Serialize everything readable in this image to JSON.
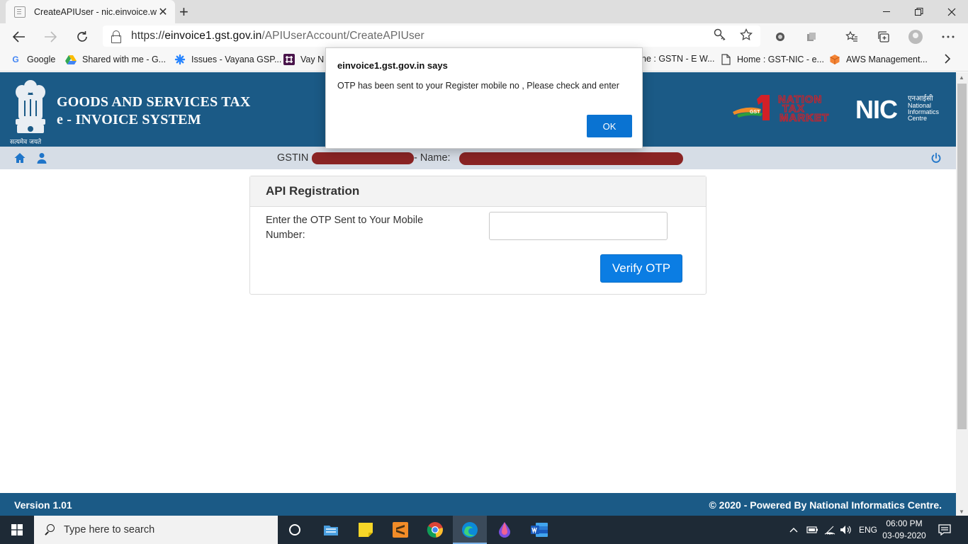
{
  "browser": {
    "tab_title": "CreateAPIUser - nic.einvoice.web",
    "tab_close": "✕",
    "new_tab": "+",
    "url_scheme": "https://",
    "url_host": "einvoice1.gst.gov.in",
    "url_path": "/APIUserAccount/CreateAPIUser",
    "bookmarks": [
      "Google",
      "Shared with me - G...",
      "Issues - Vayana GSP...",
      "Vay N",
      "ne : GSTN - E W...",
      "Home : GST-NIC - e...",
      "AWS Management..."
    ]
  },
  "header": {
    "title_line1": "GOODS AND SERVICES TAX",
    "title_line2": "e - INVOICE SYSTEM",
    "emblem_motto": "सत्यमेव जयते",
    "ntm_logo_text": [
      "NATION",
      "TAX",
      "MARKET"
    ],
    "ntm_badge": "GST",
    "nic_logo_letters": "NIC",
    "nic_logo_hindi": "एनआईसी",
    "nic_logo_sub": [
      "National",
      "Informatics",
      "Centre"
    ]
  },
  "infobar": {
    "gstin_label": "GSTIN",
    "name_label": "- Name:"
  },
  "form": {
    "card_title": "API Registration",
    "otp_label": "Enter the OTP Sent to Your Mobile Number:",
    "otp_value": "",
    "verify_button": "Verify OTP"
  },
  "footer": {
    "version": "Version 1.01",
    "copyright": "© 2020 - Powered By National Informatics Centre."
  },
  "dialog": {
    "title": "einvoice1.gst.gov.in says",
    "message": "OTP has been sent to your Register mobile no , Please check and enter",
    "ok_button": "OK"
  },
  "taskbar": {
    "search_placeholder": "Type here to search",
    "language": "ENG",
    "time": "06:00 PM",
    "date": "03-09-2020"
  },
  "colors": {
    "header_blue": "#1b5a86",
    "infobar": "#d6dde6",
    "primary_button": "#0b7de3",
    "dialog_ok": "#0a73d2",
    "redaction": "#8a2424"
  }
}
